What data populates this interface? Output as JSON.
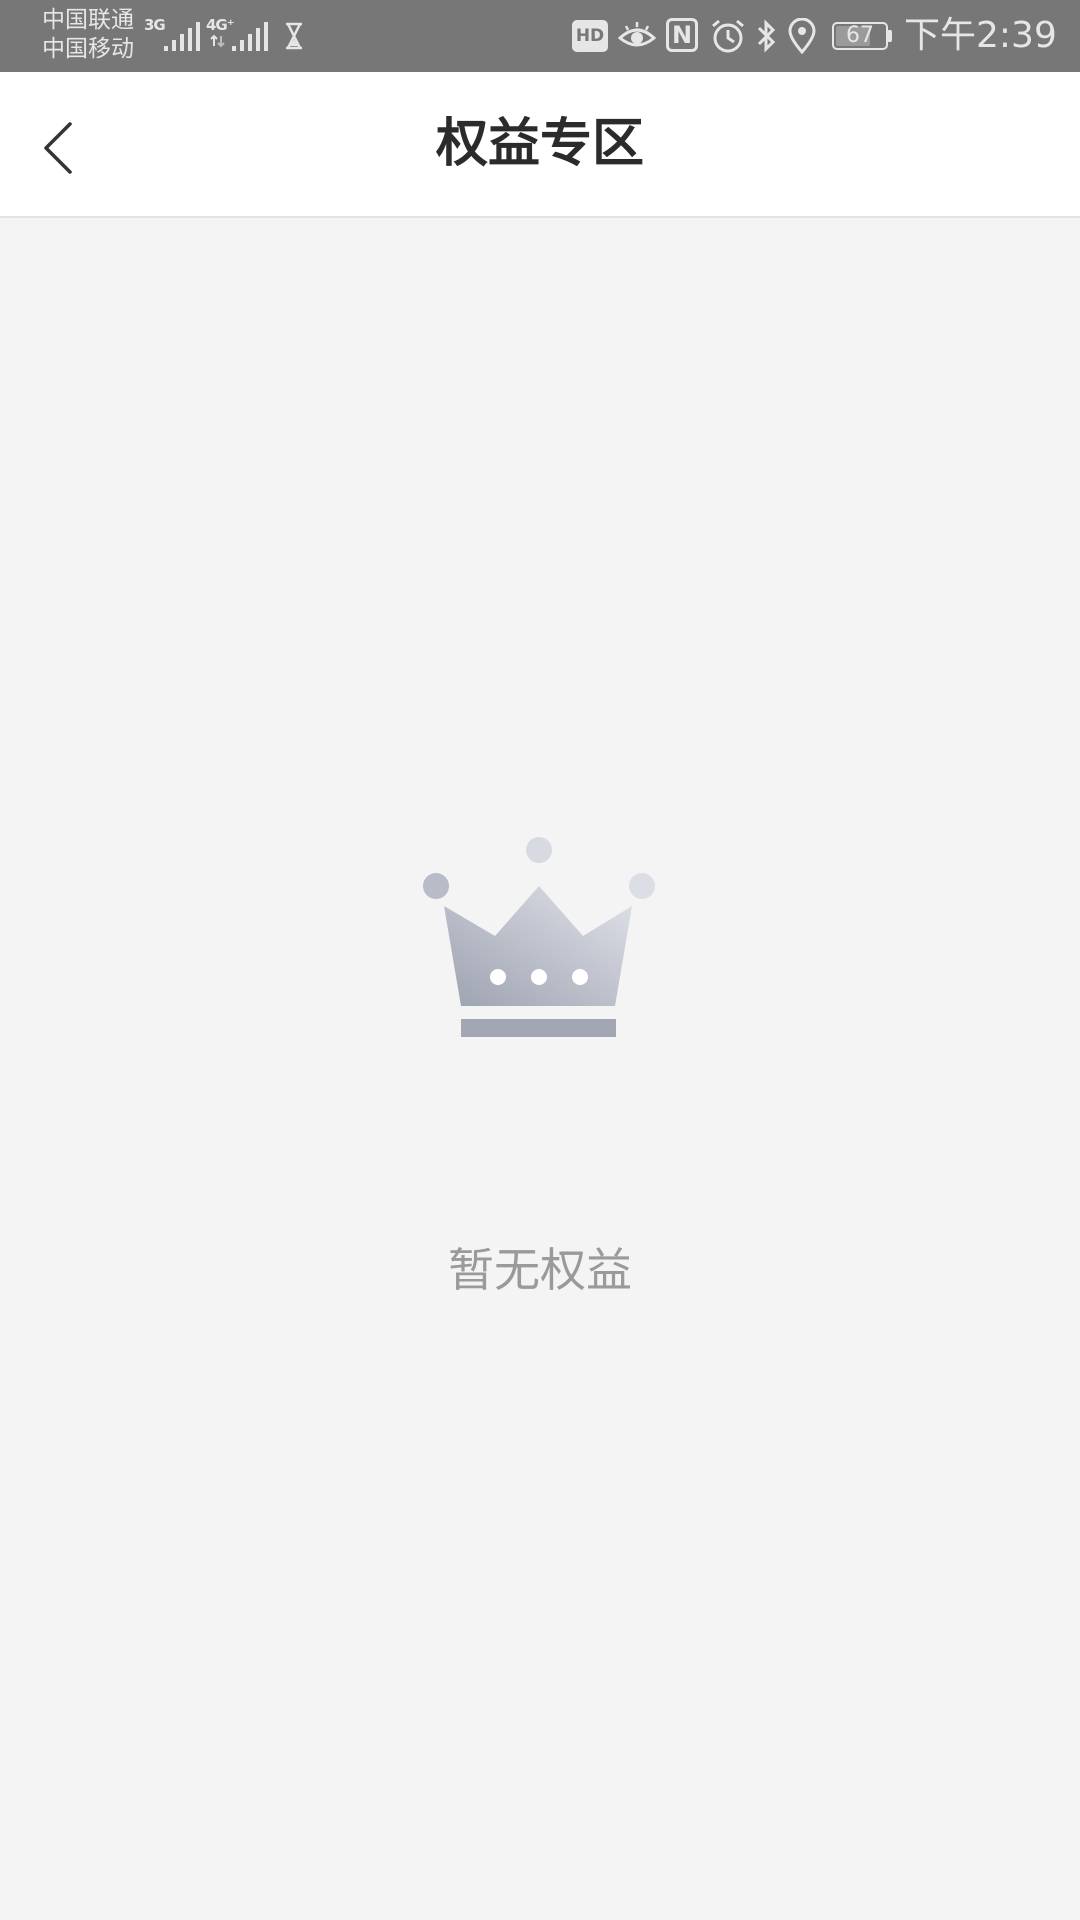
{
  "status_bar": {
    "carrier_1": "中国联通",
    "carrier_2": "中国移动",
    "network_1": "3G",
    "network_2": "4G⁺",
    "hd_badge": "HD",
    "nfc_badge": "N",
    "battery_level": "67",
    "time": "下午2:39"
  },
  "header": {
    "title": "权益专区"
  },
  "empty_state": {
    "message": "暂无权益"
  },
  "icons": {
    "back": "back-arrow-icon",
    "crown": "crown-icon"
  },
  "colors": {
    "status_bar_bg": "#777777",
    "header_bg": "#ffffff",
    "content_bg": "#f4f4f4",
    "title": "#2b2b2b",
    "empty_text": "#9a9a9a",
    "crown_light": "#d8dae2",
    "crown_dark": "#9da2b0"
  }
}
